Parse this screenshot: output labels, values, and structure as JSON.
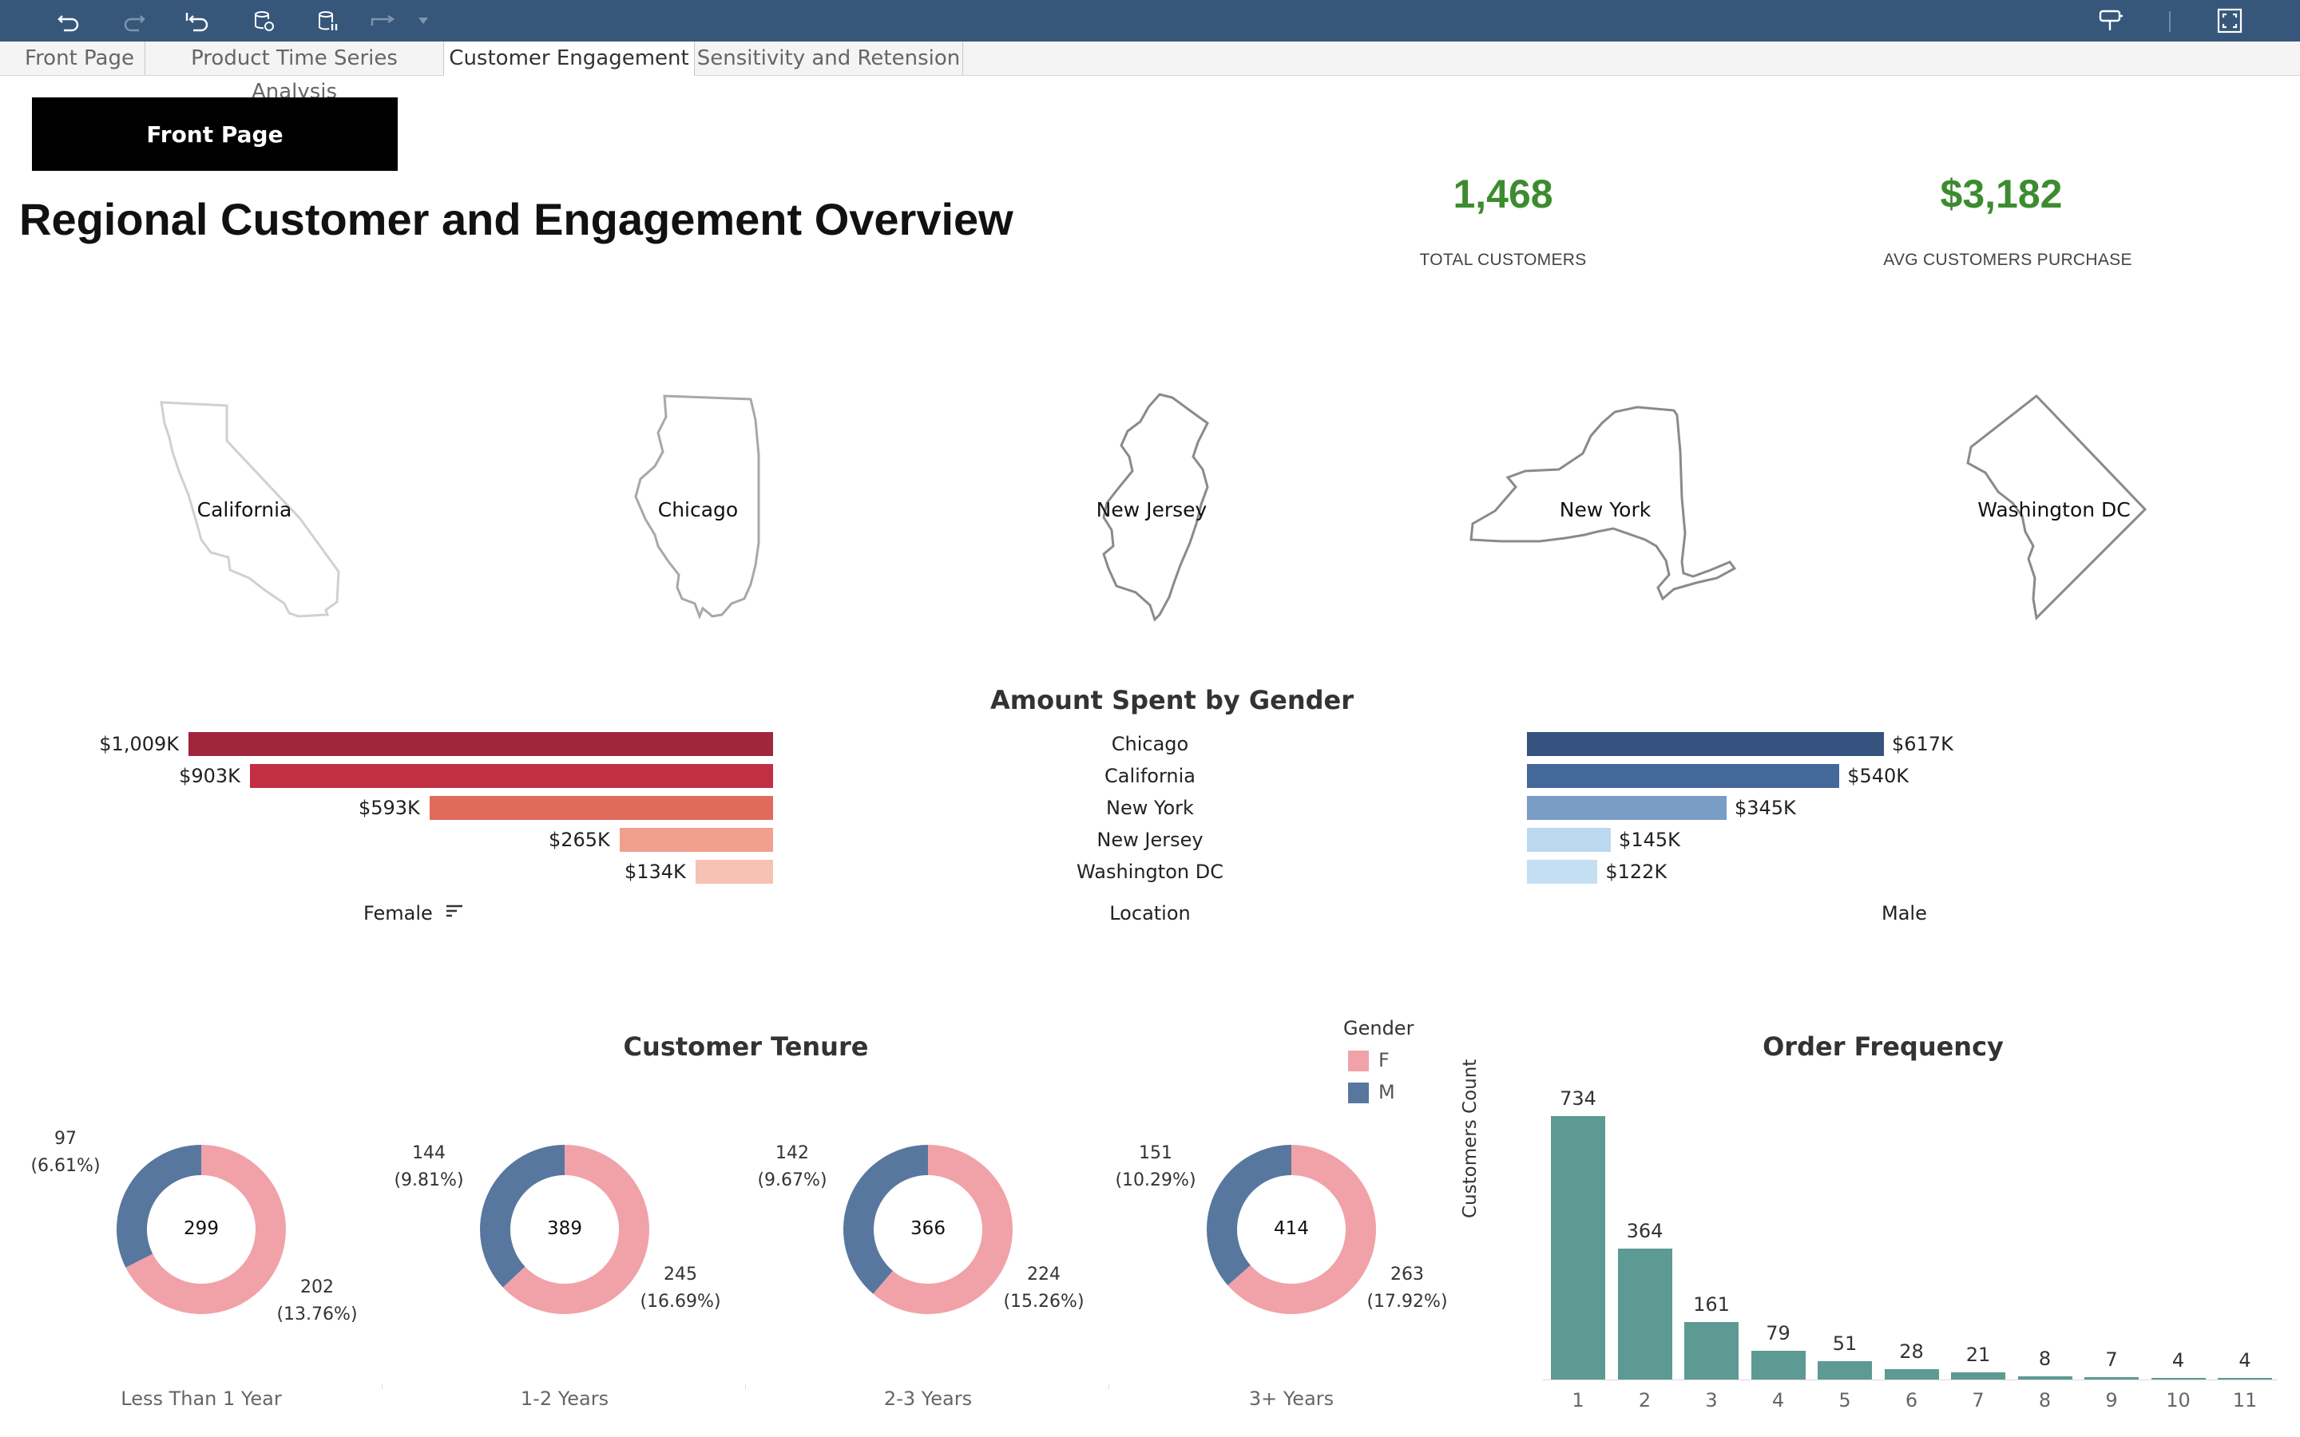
{
  "toolbar": {
    "icons": [
      "undo-icon",
      "redo-icon",
      "revert-icon",
      "refresh-datasource-icon",
      "pause-updates-icon",
      "share-icon",
      "dropdown-icon",
      "highlight-icon",
      "fullscreen-icon"
    ],
    "background": "#37577a"
  },
  "tabs": [
    {
      "label": "Front Page",
      "active": false
    },
    {
      "label": "Product Time Series Analysis",
      "active": false
    },
    {
      "label": "Customer Engagement",
      "active": true
    },
    {
      "label": "Sensitivity and Retension",
      "active": false
    }
  ],
  "front_button": {
    "label": "Front Page"
  },
  "page_title": "Regional Customer and Engagement Overview",
  "kpis": [
    {
      "value": "1,468",
      "label": "TOTAL CUSTOMERS"
    },
    {
      "value": "$3,182",
      "label": "AVG CUSTOMERS PURCHASE"
    }
  ],
  "kpi_color": "#3c8c2f",
  "maps": [
    {
      "label": "California",
      "icon": "california-outline-icon"
    },
    {
      "label": "Chicago",
      "icon": "illinois-outline-icon"
    },
    {
      "label": "New Jersey",
      "icon": "new-jersey-outline-icon"
    },
    {
      "label": "New York",
      "icon": "new-york-outline-icon"
    },
    {
      "label": "Washington DC",
      "icon": "washington-dc-outline-icon"
    }
  ],
  "gender_spend": {
    "title": "Amount Spent by Gender",
    "locations": [
      "Chicago",
      "California",
      "New York",
      "New Jersey",
      "Washington DC"
    ],
    "female": {
      "caption": "Female",
      "values_k": [
        1009,
        903,
        593,
        265,
        134
      ],
      "labels": [
        "$1,009K",
        "$903K",
        "$593K",
        "$265K",
        "$134K"
      ],
      "colors": [
        "#a0263e",
        "#c22f44",
        "#e06a5b",
        "#f0a08c",
        "#f6c2b3"
      ]
    },
    "location_caption": "Location",
    "male": {
      "caption": "Male",
      "values_k": [
        617,
        540,
        345,
        145,
        122
      ],
      "labels": [
        "$617K",
        "$540K",
        "$345K",
        "$145K",
        "$122K"
      ],
      "colors": [
        "#35537e",
        "#45689a",
        "#7a9dc6",
        "#bcd8ef",
        "#c5dff2"
      ]
    }
  },
  "tenure": {
    "title": "Customer Tenure",
    "legend": {
      "title": "Gender",
      "items": [
        {
          "label": "F",
          "color": "#f0a2a8"
        },
        {
          "label": "M",
          "color": "#58779f"
        }
      ]
    },
    "donuts": [
      {
        "category": "Less Than 1 Year",
        "total": "299",
        "m_value": 97,
        "m_pct": "(6.61%)",
        "f_value": 202,
        "f_pct": "(13.76%)"
      },
      {
        "category": "1-2 Years",
        "total": "389",
        "m_value": 144,
        "m_pct": "(9.81%)",
        "f_value": 245,
        "f_pct": "(16.69%)"
      },
      {
        "category": "2-3 Years",
        "total": "366",
        "m_value": 142,
        "m_pct": "(9.67%)",
        "f_value": 224,
        "f_pct": "(15.26%)"
      },
      {
        "category": "3+ Years",
        "total": "414",
        "m_value": 151,
        "m_pct": "(10.29%)",
        "f_value": 263,
        "f_pct": "(17.92%)"
      }
    ]
  },
  "chart_data": {
    "type": "bar",
    "title": "Order Frequency",
    "xlabel": "",
    "ylabel": "Customers Count",
    "categories": [
      "1",
      "2",
      "3",
      "4",
      "5",
      "6",
      "7",
      "8",
      "9",
      "10",
      "11"
    ],
    "values": [
      734,
      364,
      161,
      79,
      51,
      28,
      21,
      8,
      7,
      4,
      4
    ],
    "ylim": [
      0,
      734
    ],
    "color": "#5e9a94",
    "grid": false
  }
}
